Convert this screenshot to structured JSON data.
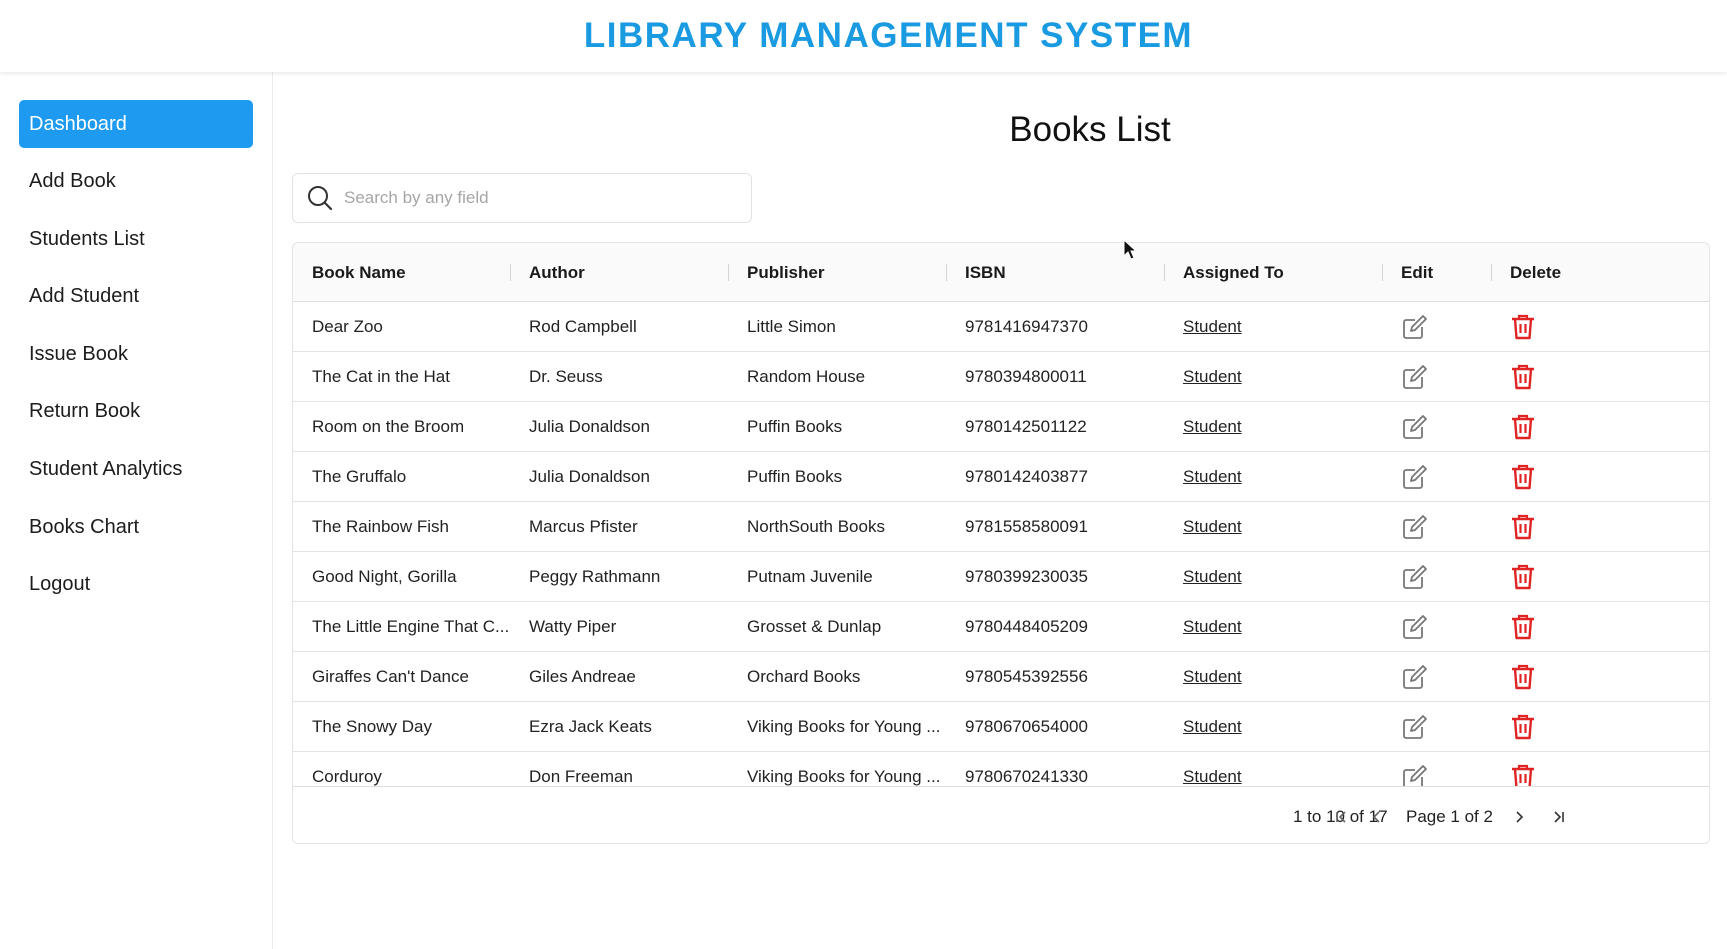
{
  "header": {
    "title": "LIBRARY MANAGEMENT SYSTEM",
    "accent_color": "#1a9ae0"
  },
  "sidebar": {
    "active_color": "#1e9bf0",
    "items": [
      {
        "label": "Dashboard",
        "active": true
      },
      {
        "label": "Add Book"
      },
      {
        "label": "Students List"
      },
      {
        "label": "Add Student"
      },
      {
        "label": "Issue Book"
      },
      {
        "label": "Return Book"
      },
      {
        "label": "Student Analytics"
      },
      {
        "label": "Books Chart"
      },
      {
        "label": "Logout"
      }
    ]
  },
  "main": {
    "title": "Books List",
    "search": {
      "placeholder": "Search by any field",
      "value": "",
      "icon": "search-icon"
    },
    "table": {
      "columns": [
        "Book Name",
        "Author",
        "Publisher",
        "ISBN",
        "Assigned To",
        "Edit",
        "Delete"
      ],
      "edit_icon": "edit-icon",
      "delete_icon": "trash-icon",
      "delete_color": "#e02424",
      "rows": [
        {
          "book": "Dear Zoo",
          "author": "Rod Campbell",
          "publisher": "Little Simon",
          "isbn": "9781416947370",
          "assigned": "Student"
        },
        {
          "book": "The Cat in the Hat",
          "author": "Dr. Seuss",
          "publisher": "Random House",
          "isbn": "9780394800011",
          "assigned": "Student"
        },
        {
          "book": "Room on the Broom",
          "author": "Julia Donaldson",
          "publisher": "Puffin Books",
          "isbn": "9780142501122",
          "assigned": "Student"
        },
        {
          "book": "The Gruffalo",
          "author": "Julia Donaldson",
          "publisher": "Puffin Books",
          "isbn": "9780142403877",
          "assigned": "Student"
        },
        {
          "book": "The Rainbow Fish",
          "author": "Marcus Pfister",
          "publisher": "NorthSouth Books",
          "isbn": "9781558580091",
          "assigned": "Student"
        },
        {
          "book": "Good Night, Gorilla",
          "author": "Peggy Rathmann",
          "publisher": "Putnam Juvenile",
          "isbn": "9780399230035",
          "assigned": "Student"
        },
        {
          "book": "The Little Engine That C...",
          "author": "Watty Piper",
          "publisher": "Grosset & Dunlap",
          "isbn": "9780448405209",
          "assigned": "Student"
        },
        {
          "book": "Giraffes Can't Dance",
          "author": "Giles Andreae",
          "publisher": "Orchard Books",
          "isbn": "9780545392556",
          "assigned": "Student"
        },
        {
          "book": "The Snowy Day",
          "author": "Ezra Jack Keats",
          "publisher": "Viking Books for Young ...",
          "isbn": "9780670654000",
          "assigned": "Student"
        },
        {
          "book": "Corduroy",
          "author": "Don Freeman",
          "publisher": "Viking Books for Young ...",
          "isbn": "9780670241330",
          "assigned": "Student"
        }
      ]
    },
    "pagination": {
      "summary": "1 to 10 of 17",
      "page_label": "Page 1 of 2",
      "icons": [
        "first-page-icon",
        "prev-page-icon",
        "next-page-icon",
        "last-page-icon"
      ]
    }
  }
}
